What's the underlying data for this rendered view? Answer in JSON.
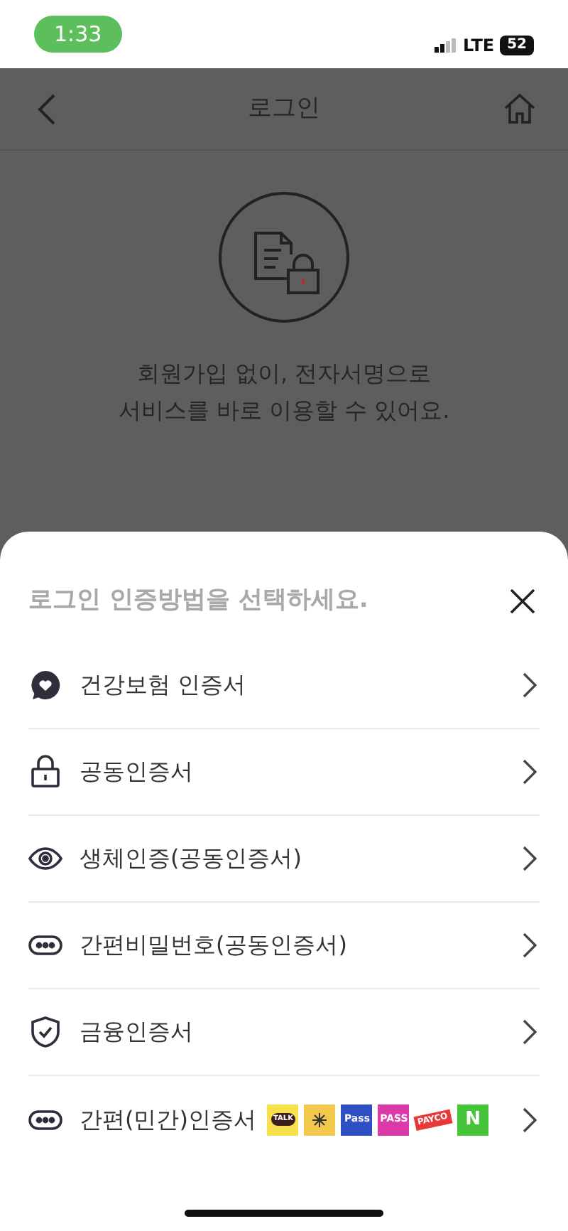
{
  "status_bar": {
    "time": "1:33",
    "network": "LTE",
    "battery": "52"
  },
  "header": {
    "title": "로그인"
  },
  "intro": {
    "message": "회원가입 없이, 전자서명으로\n서비스를 바로 이용할 수 있어요."
  },
  "sheet": {
    "title": "로그인 인증방법을 선택하세요.",
    "options": [
      {
        "kind": "health",
        "label": "건강보험 인증서"
      },
      {
        "kind": "lock",
        "label": "공동인증서"
      },
      {
        "kind": "eye",
        "label": "생체인증(공동인증서)"
      },
      {
        "kind": "dots",
        "label": "간편비밀번호(공동인증서)"
      },
      {
        "kind": "shield",
        "label": "금융인증서"
      },
      {
        "kind": "dots",
        "label": "간편(민간)인증서",
        "providers": [
          {
            "kind": "bubble",
            "label": "TALK",
            "color": "#f7e04b"
          },
          {
            "kind": "star",
            "color": "#f2c94c"
          },
          {
            "kind": "box",
            "label": "Pass",
            "color": "#2f4fc4"
          },
          {
            "kind": "box",
            "label": "PASS",
            "color": "#d93aa8"
          },
          {
            "kind": "tag",
            "label": "PAYCO",
            "color": "#e83838"
          },
          {
            "kind": "box",
            "label": "N",
            "color": "#46c43a"
          }
        ]
      }
    ]
  }
}
